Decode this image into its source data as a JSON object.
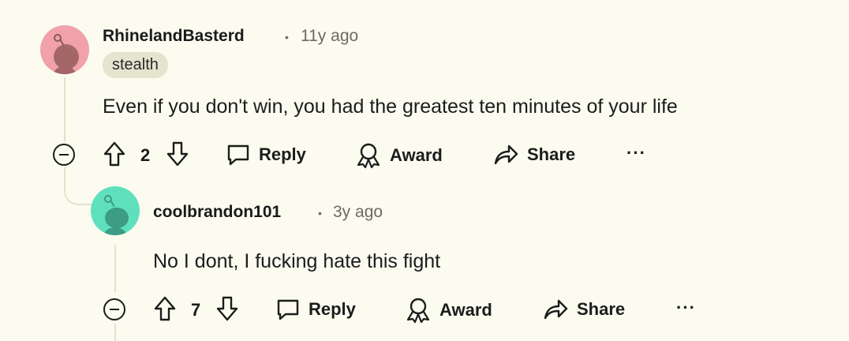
{
  "comments": [
    {
      "username": "RhinelandBasterd",
      "time": "11y ago",
      "flair": "stealth",
      "text": "Even if you don't win, you had the greatest ten minutes of your life",
      "votes": "2",
      "reply_label": "Reply",
      "award_label": "Award",
      "share_label": "Share",
      "more_label": "···",
      "avatar_color": "#f0a1aa"
    },
    {
      "username": "coolbrandon101",
      "time": "3y ago",
      "text": "No I dont, I fucking hate this fight",
      "votes": "7",
      "reply_label": "Reply",
      "award_label": "Award",
      "share_label": "Share",
      "more_label": "···",
      "avatar_color": "#5fe0bd"
    }
  ],
  "separator": "•"
}
